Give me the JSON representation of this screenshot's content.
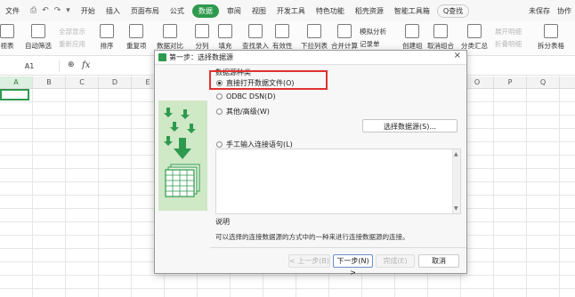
{
  "menubar": {
    "file": "文件",
    "quick_access": [
      "⎙",
      "↶",
      "↷",
      "▾"
    ],
    "tabs": [
      "开始",
      "插入",
      "页面布局",
      "公式",
      "数据",
      "审阅",
      "视图",
      "开发工具",
      "特色功能",
      "稻壳资源",
      "智能工具箱"
    ],
    "active_tab": "数据",
    "search_label": "Q查找",
    "unsaved": "未保存",
    "collab": "协作"
  },
  "ribbon": {
    "pivot": "视表",
    "auto_filter": "自动筛选",
    "show_all": "全部显示",
    "reapply": "重新应用",
    "sort": "排序",
    "duplicates": "重复项",
    "compare": "数据对比",
    "split": "分列",
    "fill": "填充",
    "find_entry": "查找录入",
    "validity": "有效性",
    "dropdown": "下拉列表",
    "consolidate": "合并计算",
    "record": "记录单",
    "simulate": "模拟分析",
    "create_group": "创建组",
    "ungroup": "取消组合",
    "subtotal": "分类汇总",
    "expand_detail": "展开明细",
    "collapse_detail": "折叠明细",
    "split_table": "拆分表格"
  },
  "formulabar": {
    "cell_ref": "A1",
    "zoom_icon": "⊕",
    "fx": "fx"
  },
  "columns": [
    "A",
    "B",
    "C",
    "D",
    "E",
    "F",
    "G",
    "H",
    "I",
    "J",
    "K",
    "L",
    "M",
    "N",
    "O",
    "P",
    "Q"
  ],
  "selected_column": "A",
  "dialog": {
    "title": "第一步：选择数据源",
    "close": "×",
    "group_label": "数据源种类",
    "options": [
      {
        "label": "直接打开数据文件(O)",
        "checked": true
      },
      {
        "label": "ODBC DSN(D)",
        "checked": false
      },
      {
        "label": "其他/高级(W)",
        "checked": false
      },
      {
        "label": "手工输入连接语句(L)",
        "checked": false
      }
    ],
    "select_source_button": "选择数据源(S)...",
    "description_title": "说明",
    "description_text": "可以选择的连接数据源的方式中的一种来进行连接数据源的连接。",
    "buttons": {
      "prev": "< 上一步(B)",
      "next": "下一步(N) >",
      "finish": "完成(E)",
      "cancel": "取消"
    },
    "highlight_color": "#e0322e"
  },
  "colors": {
    "accent": "#2e9a4d",
    "art_bg": "#cfe8c6"
  }
}
